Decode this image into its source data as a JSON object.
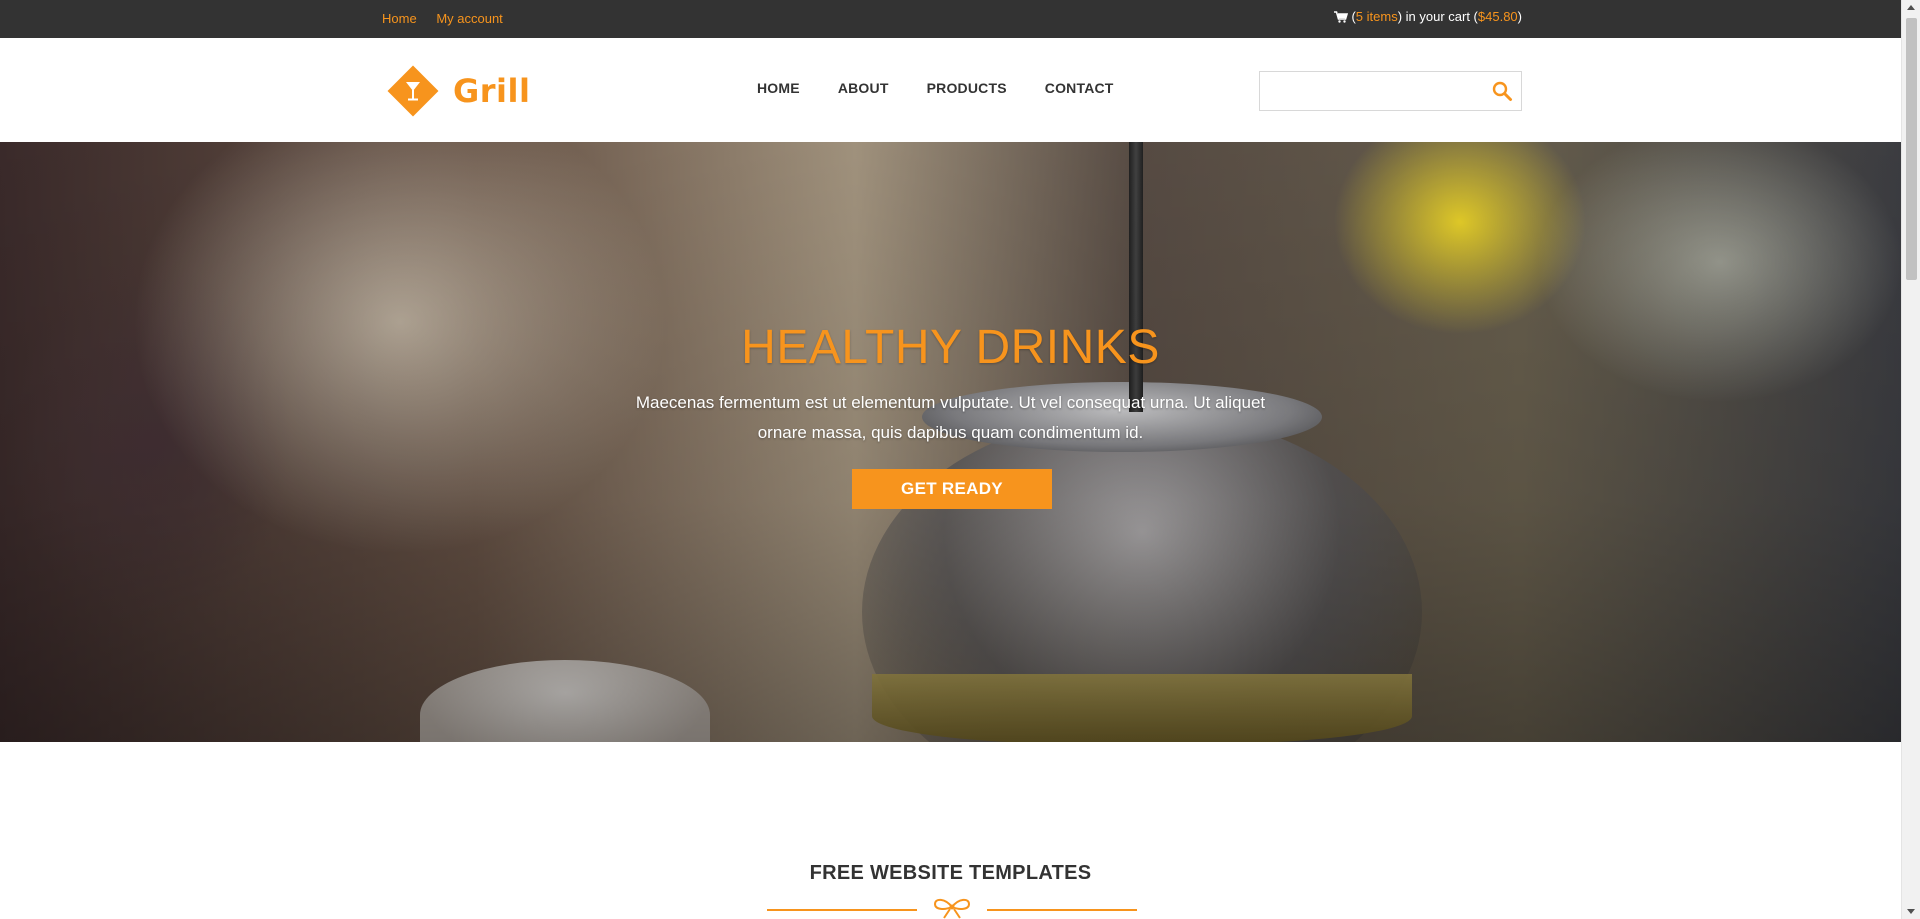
{
  "topbar": {
    "links": [
      "Home",
      "My account"
    ],
    "cart": {
      "open_paren": "(",
      "items": "5 items",
      "middle": ") in your cart (",
      "total": "$45.80",
      "close_paren": ")"
    }
  },
  "header": {
    "logo_text": "Grill",
    "nav": [
      "HOME",
      "ABOUT",
      "PRODUCTS",
      "CONTACT"
    ],
    "search": {
      "value": "",
      "placeholder": ""
    }
  },
  "hero": {
    "title": "HEALTHY DRINKS",
    "text": "Maecenas fermentum est ut elementum vulputate. Ut vel consequat urna. Ut aliquet ornare massa, quis dapibus quam condimentum id.",
    "button": "GET READY"
  },
  "section": {
    "title": "FREE WEBSITE TEMPLATES"
  },
  "colors": {
    "accent": "#f7941d",
    "topbar": "#333333",
    "text": "#333333"
  }
}
